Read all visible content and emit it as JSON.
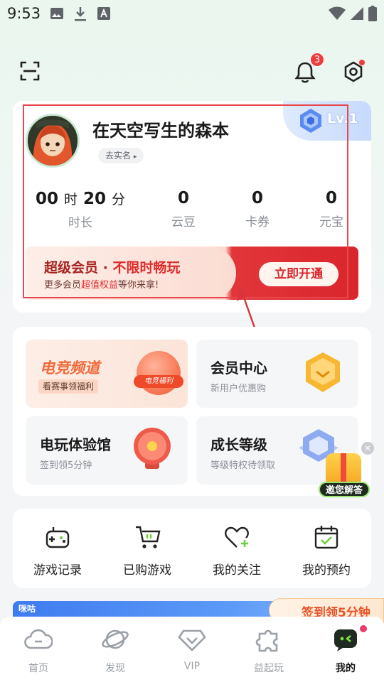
{
  "status_bar": {
    "time": "9:53"
  },
  "header": {
    "notification_count": "3"
  },
  "profile": {
    "username": "在天空写生的森本",
    "realname_label": "去实名",
    "level": "Lv.1",
    "stats": [
      {
        "value": "00",
        "unit1": "时",
        "value2": "20",
        "unit2": "分",
        "label": "时长"
      },
      {
        "value": "0",
        "label": "云豆"
      },
      {
        "value": "0",
        "label": "卡券"
      },
      {
        "value": "0",
        "label": "元宝"
      }
    ]
  },
  "vip": {
    "title_part1": "超级会员 · ",
    "title_part2": "不限时畅玩",
    "subtitle_part1": "更多会员",
    "subtitle_highlight": "超值权益",
    "subtitle_part2": "等你来拿!",
    "button": "立即开通"
  },
  "tiles": [
    {
      "title": "电竞频道",
      "subtitle": "看赛事领福利",
      "badge": "电竞福利"
    },
    {
      "title": "会员中心",
      "subtitle": "新用户优惠购"
    },
    {
      "title": "电玩体验馆",
      "subtitle": "签到领5分钟"
    },
    {
      "title": "成长等级",
      "subtitle": "等级特权待领取"
    }
  ],
  "float_help": "邀您解答",
  "shortcuts": [
    {
      "label": "游戏记录",
      "icon": "gamepad-icon"
    },
    {
      "label": "已购游戏",
      "icon": "cart-icon"
    },
    {
      "label": "我的关注",
      "icon": "heart-plus-icon"
    },
    {
      "label": "我的预约",
      "icon": "calendar-check-icon"
    }
  ],
  "promo": {
    "signin": "签到领5分钟",
    "logo": "咪咕"
  },
  "bottom_nav": [
    {
      "label": "首页",
      "icon": "cloud-icon"
    },
    {
      "label": "发现",
      "icon": "planet-icon"
    },
    {
      "label": "VIP",
      "icon": "diamond-icon"
    },
    {
      "label": "益起玩",
      "icon": "puzzle-icon"
    },
    {
      "label": "我的",
      "icon": "profile-face-icon",
      "active": true
    }
  ],
  "colors": {
    "accent_red": "#e02a2a",
    "bg_green": "#eaf6ee"
  }
}
